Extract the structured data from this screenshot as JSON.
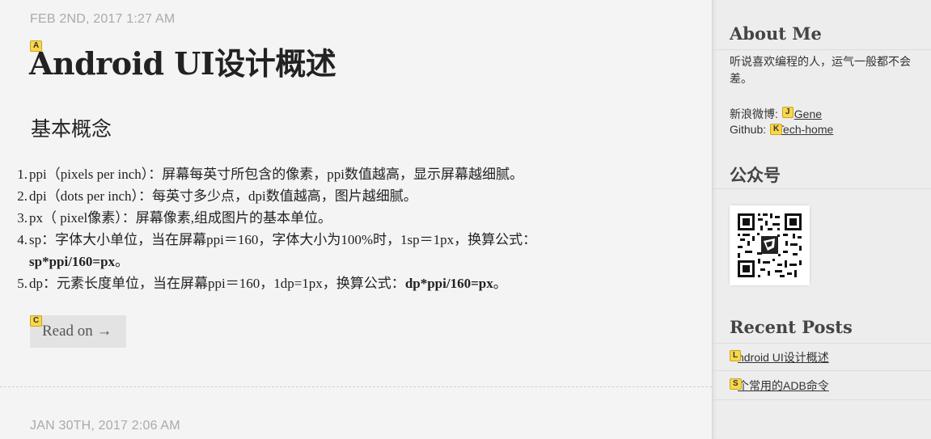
{
  "posts": [
    {
      "date": "FEB 2ND, 2017 1:27 AM",
      "title": "Android UI设计概述",
      "section_heading": "基本概念",
      "items": [
        {
          "num": "1.",
          "text": "ppi（pixels per inch）：屏幕每英寸所包含的像素，ppi数值越高，显示屏幕越细腻。"
        },
        {
          "num": "2.",
          "text": "dpi（dots per inch）：每英寸多少点，dpi数值越高，图片越细腻。"
        },
        {
          "num": "3.",
          "text": "px（ pixel像素）：屏幕像素,组成图片的基本单位。"
        },
        {
          "num": "4.",
          "text": "sp：字体大小单位，当在屏幕ppi＝160，字体大小为100%时，1sp＝1px，换算公式：",
          "formula": "sp*ppi/160=px",
          "tail": "。"
        },
        {
          "num": "5.",
          "text": "dp：元素长度单位，当在屏幕ppi＝160，1dp=1px，换算公式：",
          "formula": "dp*ppi/160=px",
          "tail": "。"
        }
      ],
      "read_on": "Read on →"
    },
    {
      "date": "JAN 30TH, 2017 2:06 AM"
    }
  ],
  "sidebar": {
    "about": {
      "heading": "About Me",
      "text": "听说喜欢编程的人，运气一般都不会差。",
      "weibo_label": "新浪微博: ",
      "weibo_link": "Gene",
      "github_label": "Github: ",
      "github_link": "Tech-home"
    },
    "wechat": {
      "heading": "公众号"
    },
    "recent": {
      "heading": "Recent Posts",
      "links": [
        {
          "text": "ndroid UI设计概述"
        },
        {
          "text": "个常用的ADB命令"
        }
      ]
    }
  },
  "hints": {
    "title": "A",
    "read_on": "C",
    "weibo": "J",
    "github": "K",
    "recent_1": "L",
    "recent_2": "S"
  },
  "colors": {
    "page_bg": "#f4f4f4",
    "sidebar_bg": "#ededed",
    "hint_bg": "#f9d64b",
    "date": "#aaaaaa"
  }
}
